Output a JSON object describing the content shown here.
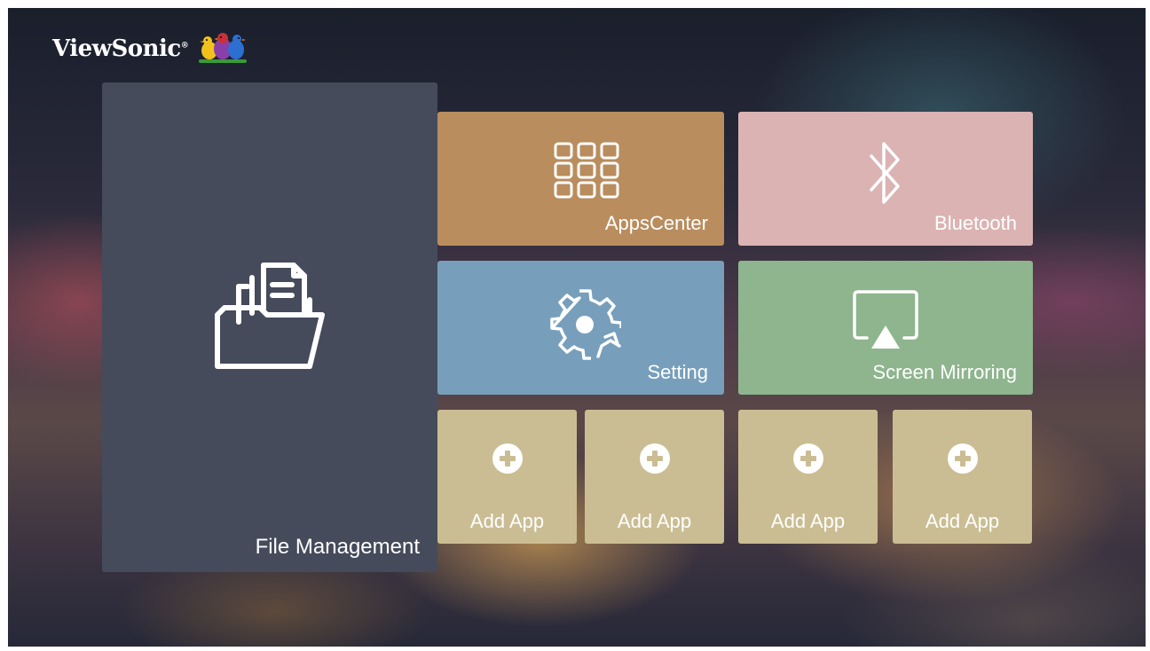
{
  "brand": {
    "name": "ViewSonic",
    "registered_mark": "®"
  },
  "tiles": {
    "featured": {
      "label": "File Management",
      "icon": "folder-documents-icon",
      "color": "#454b5b"
    },
    "apps_center": {
      "label": "AppsCenter",
      "icon": "apps-grid-icon",
      "color": "#b98d5e"
    },
    "bluetooth": {
      "label": "Bluetooth",
      "icon": "bluetooth-icon",
      "color": "#dbb3b3"
    },
    "setting": {
      "label": "Setting",
      "icon": "gear-icon",
      "color": "#779fbb"
    },
    "screen_mirroring": {
      "label": "Screen Mirroring",
      "icon": "screen-mirroring-icon",
      "color": "#8eb58d"
    }
  },
  "add_apps": [
    {
      "label": "Add App",
      "icon": "plus-circle-icon"
    },
    {
      "label": "Add App",
      "icon": "plus-circle-icon"
    },
    {
      "label": "Add App",
      "icon": "plus-circle-icon"
    },
    {
      "label": "Add App",
      "icon": "plus-circle-icon"
    }
  ],
  "add_app_color": "#cbbd93"
}
